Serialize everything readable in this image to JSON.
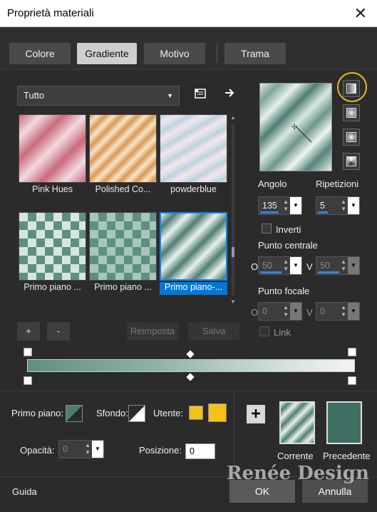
{
  "window": {
    "title": "Proprietà materiali",
    "close": "✕"
  },
  "tabs": [
    {
      "label": "Colore",
      "active": false
    },
    {
      "label": "Gradiente",
      "active": true
    },
    {
      "label": "Motivo",
      "active": false
    },
    {
      "label": "Trama",
      "active": false
    }
  ],
  "library": {
    "category": "Tutto",
    "tiles": [
      {
        "label": "Pink Hues",
        "colors": [
          "#c96b7d",
          "#f2d9de"
        ]
      },
      {
        "label": "Polished Co...",
        "colors": [
          "#d89a55",
          "#f6e4c8"
        ]
      },
      {
        "label": "powderblue",
        "colors": [
          "#b7cfdc",
          "#f2e6ee"
        ]
      },
      {
        "label": "Primo piano ...",
        "colors": [
          "#5f8f80",
          "#d7e5e1"
        ]
      },
      {
        "label": "Primo piano ...",
        "colors": [
          "#5f8f80",
          "#d7e5e1"
        ]
      },
      {
        "label": "Primo piano-...",
        "colors": [
          "#4f7f72",
          "#e9f1ef"
        ],
        "selected": true
      }
    ]
  },
  "buttons": {
    "add": "+",
    "remove": "-",
    "reset": "Reimposta",
    "save": "Salva"
  },
  "settings": {
    "angle_label": "Angolo",
    "angle_value": "135",
    "repeats_label": "Ripetizioni",
    "repeats_value": "5",
    "invert_label": "Inverti",
    "center_label": "Punto centrale",
    "center_o_label": "O",
    "center_o_value": "50",
    "center_v_label": "V",
    "center_v_value": "50",
    "focal_label": "Punto focale",
    "focal_o_label": "O",
    "focal_o_value": "0",
    "focal_v_label": "V",
    "focal_v_value": "0",
    "link_label": "Link"
  },
  "colors": {
    "foreground_label": "Primo piano:",
    "background_label": "Sfondo:",
    "user_label": "Utente:",
    "opacity_label": "Opacità:",
    "opacity_value": "0",
    "position_label": "Posizione:",
    "position_value": "0",
    "current_label": "Corrente",
    "previous_label": "Precedente",
    "current_color": "#4f7f72",
    "previous_color": "#3f6f62",
    "user_color": "#f2c21a"
  },
  "footer": {
    "guide": "Guida",
    "ok": "OK",
    "cancel": "Annulla",
    "watermark": "Renée Design"
  }
}
